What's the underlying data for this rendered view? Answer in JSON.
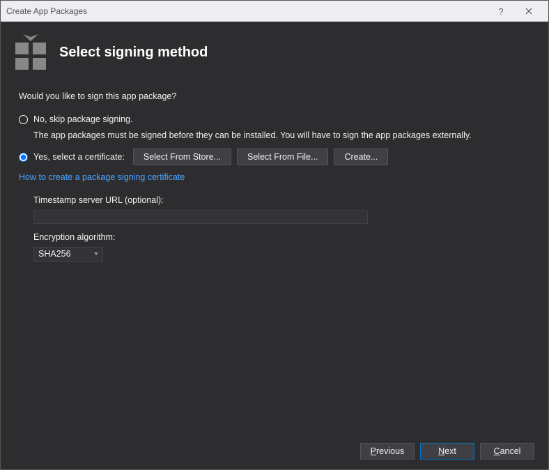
{
  "window": {
    "title": "Create App Packages"
  },
  "header": {
    "title": "Select signing method"
  },
  "main": {
    "question": "Would you like to sign this app package?",
    "radio_no_label": "No, skip package signing.",
    "radio_no_sub": "The app packages must be signed before they can be installed. You will have to sign the app packages externally.",
    "radio_yes_label": "Yes, select a certificate:",
    "btn_store": "Select From Store...",
    "btn_file": "Select From File...",
    "btn_create": "Create...",
    "help_link": "How to create a package signing certificate",
    "timestamp_label": "Timestamp server URL (optional):",
    "timestamp_value": "",
    "encryption_label": "Encryption algorithm:",
    "encryption_value": "SHA256"
  },
  "footer": {
    "previous": "Previous",
    "next": "Next",
    "cancel": "Cancel"
  }
}
